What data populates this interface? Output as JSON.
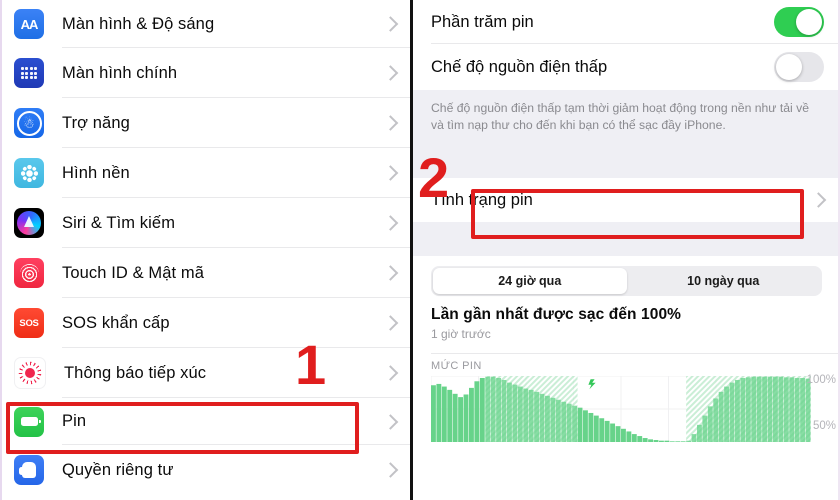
{
  "left_panel": {
    "name": "iOS Settings list",
    "items": [
      {
        "label": "Màn hình & Độ sáng",
        "icon": "display-brightness-icon",
        "chevron": "›"
      },
      {
        "label": "Màn hình chính",
        "icon": "home-screen-icon",
        "chevron": "›"
      },
      {
        "label": "Trợ năng",
        "icon": "accessibility-icon",
        "chevron": "›"
      },
      {
        "label": "Hình nền",
        "icon": "wallpaper-icon",
        "chevron": "›"
      },
      {
        "label": "Siri & Tìm kiếm",
        "icon": "siri-icon",
        "chevron": "›"
      },
      {
        "label": "Touch ID & Mật mã",
        "icon": "touch-id-icon",
        "chevron": "›"
      },
      {
        "label": "SOS khẩn cấp",
        "icon": "sos-icon",
        "chevron": "›"
      },
      {
        "label": "Thông báo tiếp xúc",
        "icon": "exposure-notification-icon",
        "chevron": "›"
      },
      {
        "label": "Pin",
        "icon": "battery-icon",
        "chevron": "›"
      },
      {
        "label": "Quyền riêng tư",
        "icon": "privacy-icon",
        "chevron": "›"
      }
    ],
    "sos_icon_text": "SOS",
    "aa_icon_text": "AA",
    "step_marker": "1"
  },
  "right_panel": {
    "rows": [
      {
        "label": "Phần trăm pin",
        "toggle": "on"
      },
      {
        "label": "Chế độ nguồn điện thấp",
        "toggle": "off"
      }
    ],
    "note": "Chế độ nguồn điện thấp tạm thời giảm hoạt động trong nền như tải về và tìm nạp thư cho đến khi bạn có thể sạc đầy iPhone.",
    "battery_health": {
      "label": "Tình trạng pin",
      "chevron": "›"
    },
    "segmented": {
      "options": [
        "24 giờ qua",
        "10 ngày qua"
      ],
      "selected": "24 giờ qua"
    },
    "last_charge": {
      "title": "Lần gần nhất được sạc đến 100%",
      "subtitle": "1 giờ trước"
    },
    "step_marker": "2"
  },
  "chart_data": {
    "type": "area",
    "title": "MỨC PIN",
    "xlabel": "",
    "ylabel": "",
    "ylim": [
      0,
      100
    ],
    "ytick_labels": [
      "100%",
      "50%"
    ],
    "ytick_values": [
      100,
      50
    ],
    "grid": true,
    "legend": null,
    "annotations": [
      {
        "text": "charging-bolt",
        "x": 42,
        "y": 95
      }
    ],
    "series": [
      {
        "name": "Mức pin",
        "values": [
          86,
          88,
          84,
          79,
          73,
          68,
          72,
          82,
          92,
          97,
          99,
          99,
          97,
          94,
          90,
          87,
          84,
          81,
          79,
          76,
          73,
          70,
          67,
          64,
          61,
          58,
          55,
          52,
          48,
          44,
          40,
          36,
          32,
          28,
          24,
          20,
          16,
          12,
          9,
          6,
          4,
          3,
          2,
          2,
          1,
          1,
          1,
          2,
          12,
          26,
          40,
          54,
          66,
          76,
          84,
          90,
          94,
          97,
          98,
          99,
          99,
          99,
          99,
          99,
          99,
          98,
          98,
          97,
          97,
          96
        ]
      }
    ],
    "charging_bands": [
      [
        10,
        27
      ],
      [
        47,
        70
      ]
    ],
    "colors": {
      "fill": "#67d38a",
      "fill_charging": "#b8e8c8",
      "grid": "#f0f0f2",
      "tick_text": "#b4b4b9"
    }
  },
  "style": {
    "accent_green": "#2fce52",
    "highlight_red": "#e01e1e",
    "note_bg": "#efeff4",
    "text_primary": "#0b0b0b",
    "text_secondary": "#9a9a9f"
  }
}
